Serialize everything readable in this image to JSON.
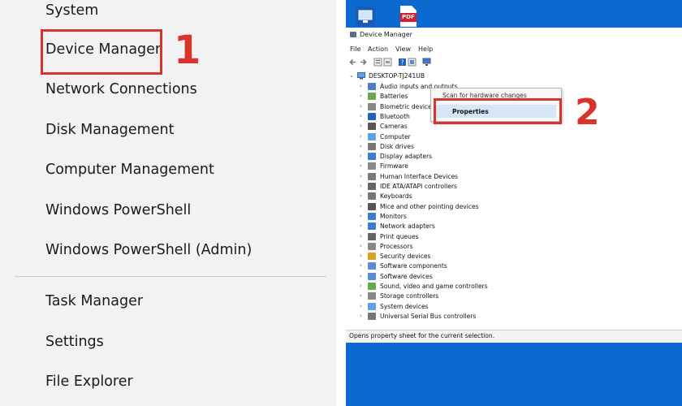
{
  "winx_menu": {
    "items": [
      "System",
      "Device Manager",
      "Network Connections",
      "Disk Management",
      "Computer Management",
      "Windows PowerShell",
      "Windows PowerShell (Admin)"
    ],
    "items2": [
      "Task Manager",
      "Settings",
      "File Explorer"
    ]
  },
  "steps": {
    "one": "1",
    "two": "2"
  },
  "desktop": {
    "pdf_icon_label": "PDF"
  },
  "device_manager": {
    "title": "Device Manager",
    "menu": [
      "File",
      "Action",
      "View",
      "Help"
    ],
    "root": "DESKTOP-TJ241UB",
    "categories": [
      "Audio inputs and outputs",
      "Batteries",
      "Biometric devices",
      "Bluetooth",
      "Cameras",
      "Computer",
      "Disk drives",
      "Display adapters",
      "Firmware",
      "Human Interface Devices",
      "IDE ATA/ATAPI controllers",
      "Keyboards",
      "Mice and other pointing devices",
      "Monitors",
      "Network adapters",
      "Print queues",
      "Processors",
      "Security devices",
      "Software components",
      "Software devices",
      "Sound, video and game controllers",
      "Storage controllers",
      "System devices",
      "Universal Serial Bus controllers"
    ],
    "context_menu": {
      "scan": "Scan for hardware changes",
      "properties": "Properties"
    },
    "status": "Opens property sheet for the current selection."
  },
  "colors": {
    "accent_red": "#d9342b",
    "desktop_blue": "#0a6ad0"
  }
}
